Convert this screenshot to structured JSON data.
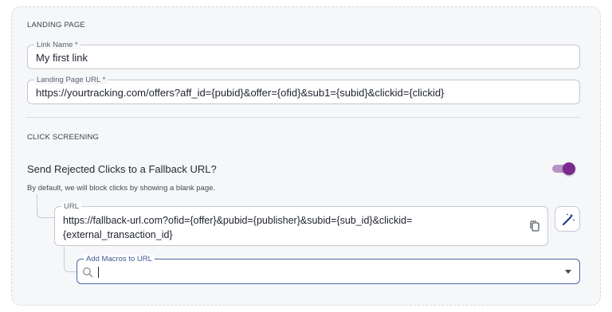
{
  "landing_page": {
    "section_title": "LANDING PAGE",
    "link_name": {
      "label": "Link Name *",
      "value": "My first link"
    },
    "landing_url": {
      "label": "Landing Page URL *",
      "value": "https://yourtracking.com/offers?aff_id={pubid}&offer={ofid}&sub1={subid}&clickid={clickid}"
    }
  },
  "click_screening": {
    "section_title": "CLICK SCREENING",
    "toggle_label": "Send Rejected Clicks to a Fallback URL?",
    "toggle_on": true,
    "help_text": "By default, we will block clicks by showing a blank page.",
    "fallback_url": {
      "label": "URL",
      "value": "https://fallback-url.com?ofid={offer}&pubid={publisher}&subid={sub_id}&clickid={external_transaction_id}"
    },
    "macros": {
      "label": "Add Macros to URL",
      "value": ""
    }
  },
  "icons": {
    "copy": "copy-icon",
    "magic": "magic-wand-icon",
    "search": "search-icon",
    "dropdown": "chevron-down-icon"
  },
  "colors": {
    "toggle_thumb": "#7b2a8f",
    "toggle_track": "#b894c6",
    "focus_border": "#4a68a8"
  }
}
